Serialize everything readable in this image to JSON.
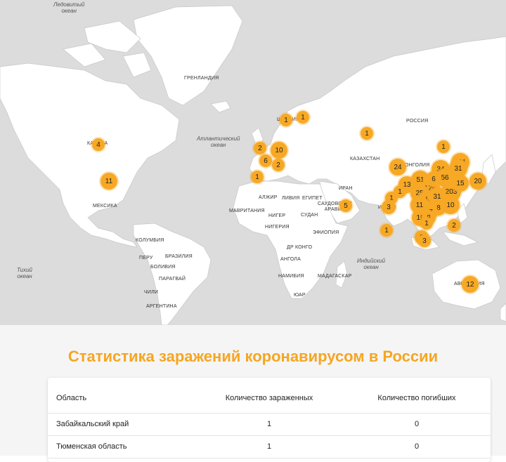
{
  "ocean_labels": {
    "arctic": "Ледовитый\nокеан",
    "atlantic": "Атлантический\nокеан",
    "pacific": "Тихий\nокеан",
    "indian": "Индийский\nокеан"
  },
  "country_labels": {
    "greenland": "ГРЕНЛАНДИЯ",
    "sweden": "ШВЕЦИЯ",
    "russia": "РОССИЯ",
    "kazakhstan": "КАЗАХСТАН",
    "mongolia": "МОНГОЛИЯ",
    "iran": "ИРАН",
    "india": "ИНДИЯ",
    "saudi": "САУДОВСКАЯ\nАРАВИЯ",
    "canada": "КАНАДА",
    "mexico": "МЕКСИКА",
    "algeria": "АЛЖИР",
    "libya": "ЛИВИЯ",
    "egypt": "ЕГИПЕТ",
    "mauritania": "МАВРИТАНИЯ",
    "niger": "НИГЕР",
    "sudan": "СУДАН",
    "nigeria": "НИГЕРИЯ",
    "ethiopia": "ЭФИОПИЯ",
    "drc": "ДР КОНГО",
    "angola": "АНГОЛА",
    "namibia": "НАМИБИЯ",
    "madagascar": "МАДАГАСКАР",
    "sa": "ЮАР",
    "colombia": "КОЛУМБИЯ",
    "peru": "ПЕРУ",
    "brazil": "БРАЗИЛИЯ",
    "bolivia": "БОЛИВИЯ",
    "paraguay": "ПАРАГВАЙ",
    "chile": "ЧИЛИ",
    "argentina": "АРГЕНТИНА",
    "australia": "АВСТРАЛИЯ"
  },
  "markers": [
    {
      "label": "1"
    },
    {
      "label": "1"
    },
    {
      "label": "4"
    },
    {
      "label": "11"
    },
    {
      "label": "2"
    },
    {
      "label": "10"
    },
    {
      "label": "6"
    },
    {
      "label": "2"
    },
    {
      "label": "1"
    },
    {
      "label": "1"
    },
    {
      "label": "5"
    },
    {
      "label": "24"
    },
    {
      "label": "1"
    },
    {
      "label": "121"
    },
    {
      "label": "34"
    },
    {
      "label": "31"
    },
    {
      "label": "20"
    },
    {
      "label": "51"
    },
    {
      "label": "13"
    },
    {
      "label": "1"
    },
    {
      "label": "126"
    },
    {
      "label": "56"
    },
    {
      "label": "6"
    },
    {
      "label": "25"
    },
    {
      "label": "203"
    },
    {
      "label": "15"
    },
    {
      "label": "1"
    },
    {
      "label": "3"
    },
    {
      "label": "40"
    },
    {
      "label": "31"
    },
    {
      "label": "11"
    },
    {
      "label": "8"
    },
    {
      "label": "10"
    },
    {
      "label": "7"
    },
    {
      "label": "19"
    },
    {
      "label": "8"
    },
    {
      "label": "1"
    },
    {
      "label": "2"
    },
    {
      "label": "1"
    },
    {
      "label": "8"
    },
    {
      "label": "3"
    },
    {
      "label": "12"
    }
  ],
  "stats": {
    "title": "Статистика заражений коронавирусом в России",
    "headers": {
      "region": "Область",
      "infected": "Количество зараженных",
      "deaths": "Количество погибших"
    },
    "rows": [
      {
        "region": "Забайкальский край",
        "infected": "1",
        "deaths": "0"
      },
      {
        "region": "Тюменская область",
        "infected": "1",
        "deaths": "0"
      }
    ]
  }
}
